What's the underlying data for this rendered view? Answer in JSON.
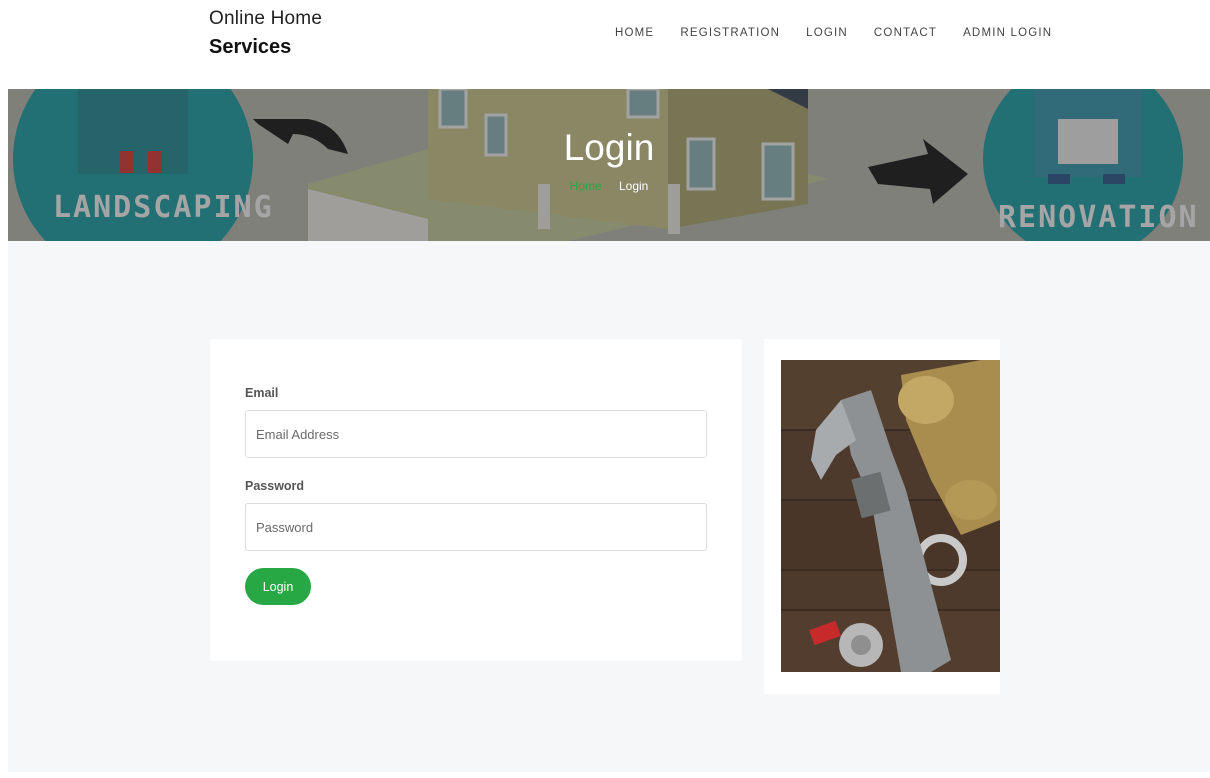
{
  "brand": {
    "line1": "Online Home",
    "line2": "Services"
  },
  "nav": {
    "items": [
      {
        "label": "HOME"
      },
      {
        "label": "REGISTRATION"
      },
      {
        "label": "LOGIN"
      },
      {
        "label": "CONTACT"
      },
      {
        "label": "ADMIN LOGIN"
      }
    ]
  },
  "hero": {
    "title": "Login",
    "breadcrumb": {
      "home": "Home",
      "current": "Login"
    },
    "left_sign": "LANDSCAPING",
    "right_sign": "RENOVATION"
  },
  "form": {
    "email_label": "Email",
    "email_placeholder": "Email Address",
    "email_value": "",
    "password_label": "Password",
    "password_placeholder": "Password",
    "password_value": "",
    "submit_label": "Login"
  },
  "colors": {
    "accent": "#28a745",
    "page_bg": "#f6f7f9",
    "teal": "#1f9ba3"
  },
  "icons": [
    "landscaping-illustration",
    "renovation-illustration",
    "house-illustration",
    "wrench-tools-photo"
  ]
}
